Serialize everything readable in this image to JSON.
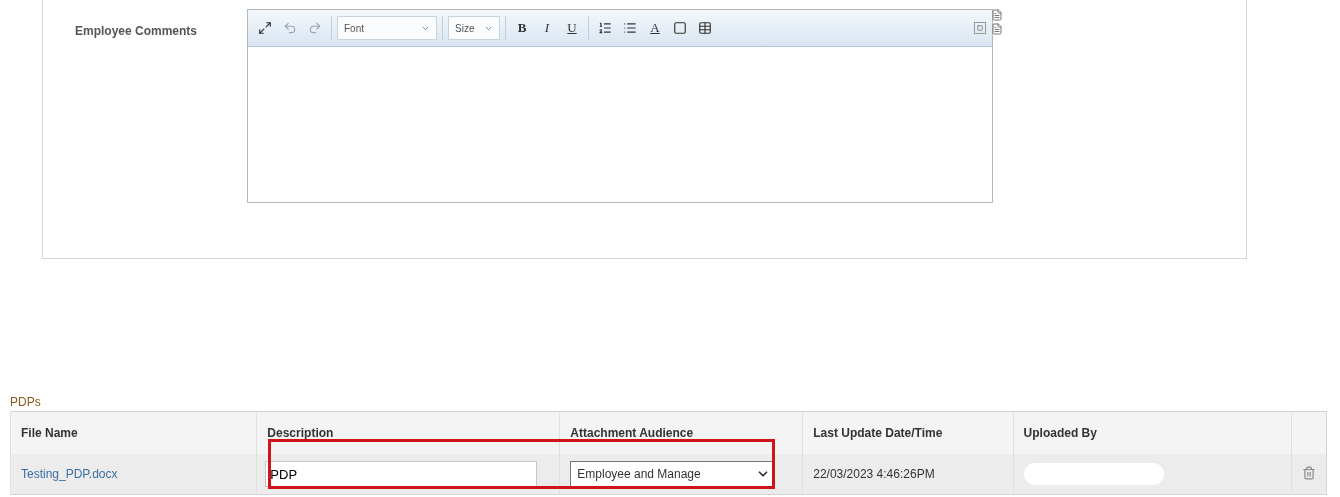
{
  "comments": {
    "label": "Employee Comments",
    "toolbar": [
      {
        "kind": "icon"
      },
      {
        "kind": "icon",
        "disabled": true
      },
      {
        "kind": "icon",
        "disabled": true
      },
      {
        "kind": "sep"
      },
      {
        "kind": "dropdown",
        "label": "Font"
      },
      {
        "kind": "sep"
      },
      {
        "kind": "dropdown",
        "label": "Size"
      },
      {
        "kind": "sep"
      },
      {
        "kind": "letter",
        "label": "B"
      },
      {
        "kind": "letter",
        "label": "I"
      },
      {
        "kind": "letter",
        "label": "U"
      },
      {
        "kind": "sep"
      },
      {
        "kind": "icon"
      },
      {
        "kind": "icon"
      },
      {
        "kind": "color",
        "label": "A"
      },
      {
        "kind": "icon"
      },
      {
        "kind": "icon"
      }
    ]
  },
  "pdps": {
    "title": "PDPs",
    "columns": [
      "File Name",
      "Description",
      "Attachment Audience",
      "Last Update Date/Time",
      "Uploaded By"
    ],
    "rows": [
      {
        "file": "Testing_PDP.docx",
        "description": "PDP",
        "audience": "Employee and Manage",
        "updated": "22/03/2023  4:46:26PM",
        "uploaded_by_redacted": true
      }
    ],
    "highlighted": true
  }
}
